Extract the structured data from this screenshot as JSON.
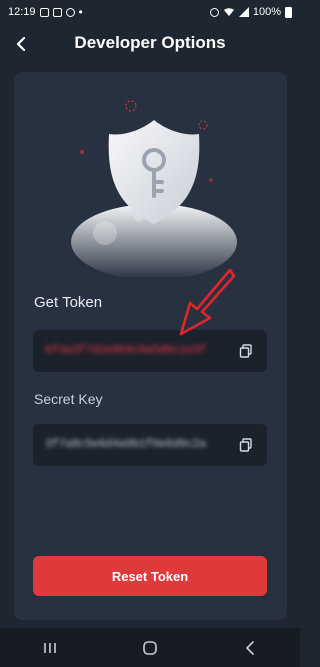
{
  "status_bar": {
    "time": "12:19",
    "battery": "100%"
  },
  "header": {
    "title": "Developer Options"
  },
  "card": {
    "get_token_label": "Get Token",
    "token_value": "bf4a3f7d2e8b9c0a5d6c1e3f",
    "secret_key_label": "Secret Key",
    "secret_key_value": "3f7a8c5e6d4a9b1f0e6d9c2a",
    "reset_button_label": "Reset Token"
  },
  "colors": {
    "background": "#1e2631",
    "card": "#283140",
    "field": "#1b222c",
    "accent_red": "#e0393b"
  },
  "icons": {
    "back": "chevron-left-icon",
    "copy": "copy-icon",
    "hero": "shield-key-icon"
  }
}
